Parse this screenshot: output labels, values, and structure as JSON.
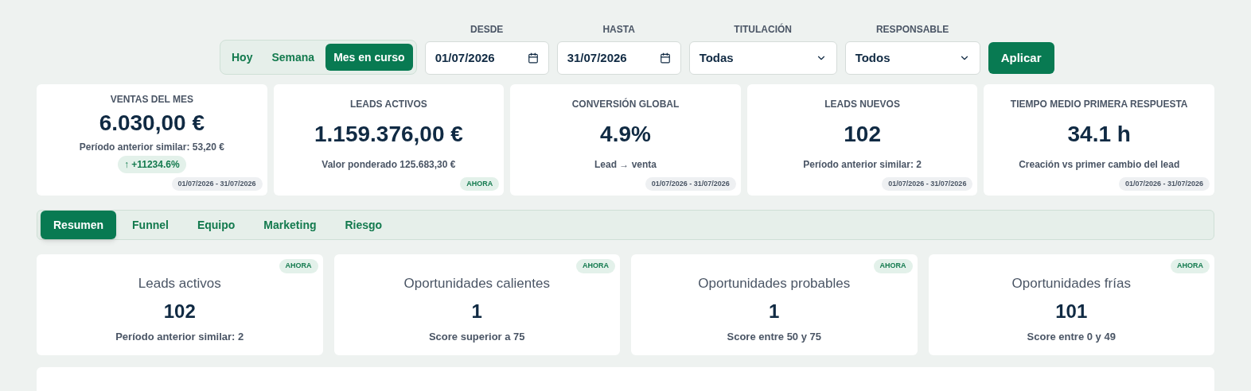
{
  "period_toggle": [
    {
      "label": "Hoy",
      "selected": false
    },
    {
      "label": "Semana",
      "selected": false
    },
    {
      "label": "Mes en curso",
      "selected": true
    }
  ],
  "filters": [
    {
      "kind": "date",
      "label": "DESDE",
      "value": "01/07/2026"
    },
    {
      "kind": "date",
      "label": "HASTA",
      "value": "31/07/2026"
    },
    {
      "kind": "select",
      "label": "TITULACIÓN",
      "value": "Todas"
    },
    {
      "kind": "select",
      "label": "RESPONSABLE",
      "value": "Todos"
    }
  ],
  "apply_button": "Aplicar",
  "kpis": [
    {
      "title": "VENTAS DEL MES",
      "value": "6.030,00 €",
      "subtitle": "Período anterior similar: 53,20 €",
      "trend": "↑ +11234.6%",
      "badge": {
        "kind": "date",
        "text": "01/07/2026 - 31/07/2026"
      }
    },
    {
      "title": "LEADS ACTIVOS",
      "value": "1.159.376,00 €",
      "subtitle": "Valor ponderado 125.683,30 €",
      "badge": {
        "kind": "now",
        "text": "AHORA"
      }
    },
    {
      "title": "CONVERSIÓN GLOBAL",
      "value": "4.9%",
      "subtitle": "Lead → venta",
      "badge": {
        "kind": "date",
        "text": "01/07/2026 - 31/07/2026"
      }
    },
    {
      "title": "LEADS NUEVOS",
      "value": "102",
      "subtitle": "Período anterior similar: 2",
      "badge": {
        "kind": "date",
        "text": "01/07/2026 - 31/07/2026"
      }
    },
    {
      "title": "TIEMPO MEDIO PRIMERA RESPUESTA",
      "value": "34.1 h",
      "subtitle": "Creación vs primer cambio del lead",
      "badge": {
        "kind": "date",
        "text": "01/07/2026 - 31/07/2026"
      }
    }
  ],
  "tabs": [
    {
      "label": "Resumen",
      "selected": true
    },
    {
      "label": "Funnel",
      "selected": false
    },
    {
      "label": "Equipo",
      "selected": false
    },
    {
      "label": "Marketing",
      "selected": false
    },
    {
      "label": "Riesgo",
      "selected": false
    }
  ],
  "lead_cards": [
    {
      "title": "Leads activos",
      "value": "102",
      "subtitle": "Período anterior similar: 2",
      "badge": "AHORA"
    },
    {
      "title": "Oportunidades calientes",
      "value": "1",
      "subtitle": "Score superior a 75",
      "badge": "AHORA"
    },
    {
      "title": "Oportunidades probables",
      "value": "1",
      "subtitle": "Score entre 50 y 75",
      "badge": "AHORA"
    },
    {
      "title": "Oportunidades frías",
      "value": "101",
      "subtitle": "Score entre 0 y 49",
      "badge": "AHORA"
    }
  ]
}
